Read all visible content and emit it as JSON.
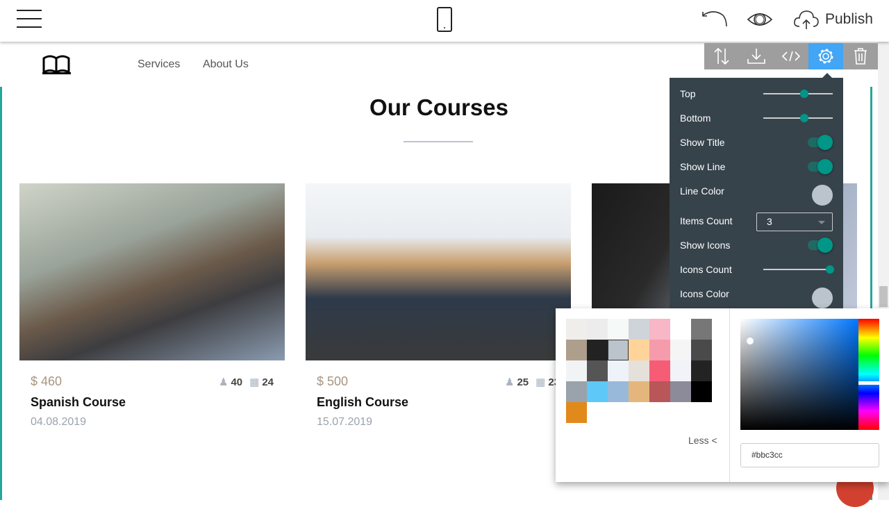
{
  "topbar": {
    "publish_label": "Publish",
    "icons": [
      "hamburger-menu-icon",
      "mobile-phone-icon",
      "undo-icon",
      "eye-icon",
      "cloud-upload-icon"
    ]
  },
  "site": {
    "nav": {
      "logo_icon": "open-book-icon",
      "items": [
        "Services",
        "About Us"
      ]
    },
    "section_title": "Our Courses",
    "line_color": "#bbc3cc",
    "courses": [
      {
        "price": "$ 460",
        "students": "40",
        "days": "24",
        "name": "Spanish Course",
        "date": "04.08.2019"
      },
      {
        "price": "$ 500",
        "students": "25",
        "days": "23",
        "name": "English Course",
        "date": "15.07.2019"
      },
      {
        "price": "",
        "students": "",
        "days": "",
        "name": "",
        "date": ""
      }
    ]
  },
  "block_toolbar": {
    "buttons": [
      "move-icon",
      "download-icon",
      "code-icon",
      "gear-icon",
      "trash-icon"
    ],
    "active": "gear-icon",
    "active_color": "#42a5f5"
  },
  "settings": {
    "top_label": "Top",
    "top_value": 0.6,
    "bottom_label": "Bottom",
    "bottom_value": 0.6,
    "show_title_label": "Show Title",
    "show_title": true,
    "show_line_label": "Show Line",
    "show_line": true,
    "line_color_label": "Line Color",
    "line_color": "#bbc3cc",
    "items_count_label": "Items Count",
    "items_count": "3",
    "show_icons_label": "Show Icons",
    "show_icons": true,
    "icons_count_label": "Icons Count",
    "icons_count_value": 1.0,
    "icons_color_label": "Icons Color",
    "icons_color": "#bbc3cc"
  },
  "color_picker": {
    "palette": [
      "#efeeeb",
      "#ececec",
      "#f5f9f7",
      "#cfd4db",
      "#f8b7c6",
      "#ffffff",
      "#777777",
      "#ae9e8c",
      "#222222",
      "#bbc3cc",
      "#fed49a",
      "#f59bab",
      "#f5f5f5",
      "#4a4a4a",
      "#f2f3f5",
      "#555555",
      "#eef3fa",
      "#e5e0d9",
      "#f75c77",
      "#f1f3f8",
      "#232323",
      "#9aa3ab",
      "#5ec8f8",
      "#99b9da",
      "#e5b67c",
      "#b85659",
      "#8b8b99",
      "#000000",
      "#e2891c"
    ],
    "selected": "#bbc3cc",
    "less_label": "Less <",
    "hex_value": "#bbc3cc"
  }
}
